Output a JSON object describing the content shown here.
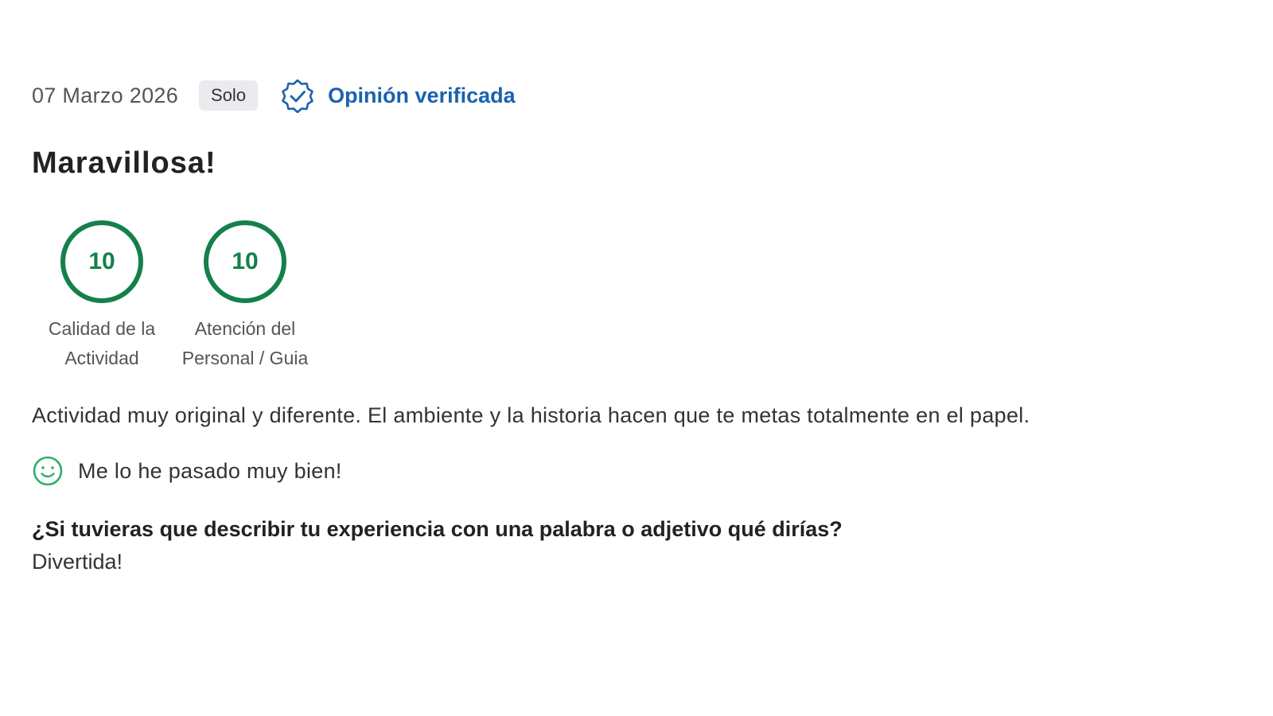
{
  "review": {
    "date": "07 Marzo 2026",
    "traveler_type": "Solo",
    "verified_label": "Opinión verificada",
    "title": "Maravillosa!",
    "scores": [
      {
        "value": "10",
        "label": "Calidad de la Actividad"
      },
      {
        "value": "10",
        "label": "Atención del Personal / Guia"
      }
    ],
    "body": "Actividad muy original y diferente. El ambiente y la historia hacen que te metas totalmente en el papel.",
    "mood": "Me lo he pasado muy bien!",
    "question": "¿Si tuvieras que describir tu experiencia con una palabra o adjetivo qué dirías?",
    "answer": "Divertida!"
  },
  "colors": {
    "verified_blue": "#1a62b0",
    "score_green": "#14804a",
    "smile_green": "#2fae6b"
  },
  "icons": {
    "verified": "verified-badge-icon",
    "mood": "smiley-face-icon"
  }
}
